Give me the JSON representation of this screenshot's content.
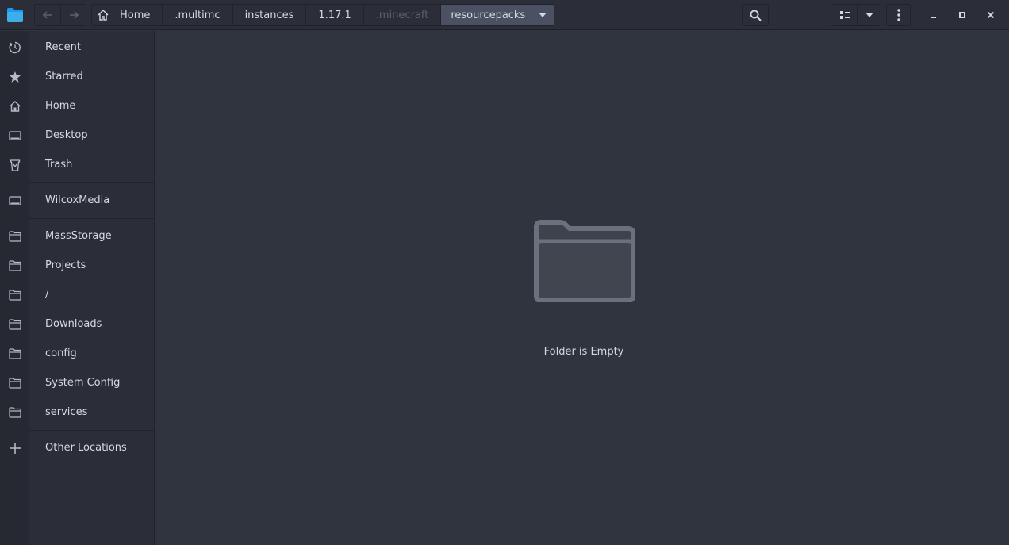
{
  "breadcrumb": [
    "Home",
    ".multimc",
    "instances",
    "1.17.1",
    ".minecraft",
    "resourcepacks"
  ],
  "sidebar": {
    "items": [
      {
        "label": "Recent",
        "icon": "clock-icon"
      },
      {
        "label": "Starred",
        "icon": "star-icon"
      },
      {
        "label": "Home",
        "icon": "home-icon"
      },
      {
        "label": "Desktop",
        "icon": "desktop-icon"
      },
      {
        "label": "Trash",
        "icon": "trash-icon"
      },
      {
        "label": "WilcoxMedia",
        "icon": "drive-icon"
      },
      {
        "label": "MassStorage",
        "icon": "folder-icon"
      },
      {
        "label": "Projects",
        "icon": "folder-icon"
      },
      {
        "label": "/",
        "icon": "folder-icon"
      },
      {
        "label": "Downloads",
        "icon": "folder-icon"
      },
      {
        "label": "config",
        "icon": "folder-icon"
      },
      {
        "label": "System Config",
        "icon": "folder-icon"
      },
      {
        "label": "services",
        "icon": "folder-icon"
      },
      {
        "label": "Other Locations",
        "icon": "plus-icon"
      }
    ]
  },
  "main": {
    "empty_message": "Folder is Empty"
  },
  "colors": {
    "accent": "#4b5162",
    "folder_blue": "#3daee9",
    "background": "#2f343f",
    "sidebar": "#2b2e39"
  }
}
